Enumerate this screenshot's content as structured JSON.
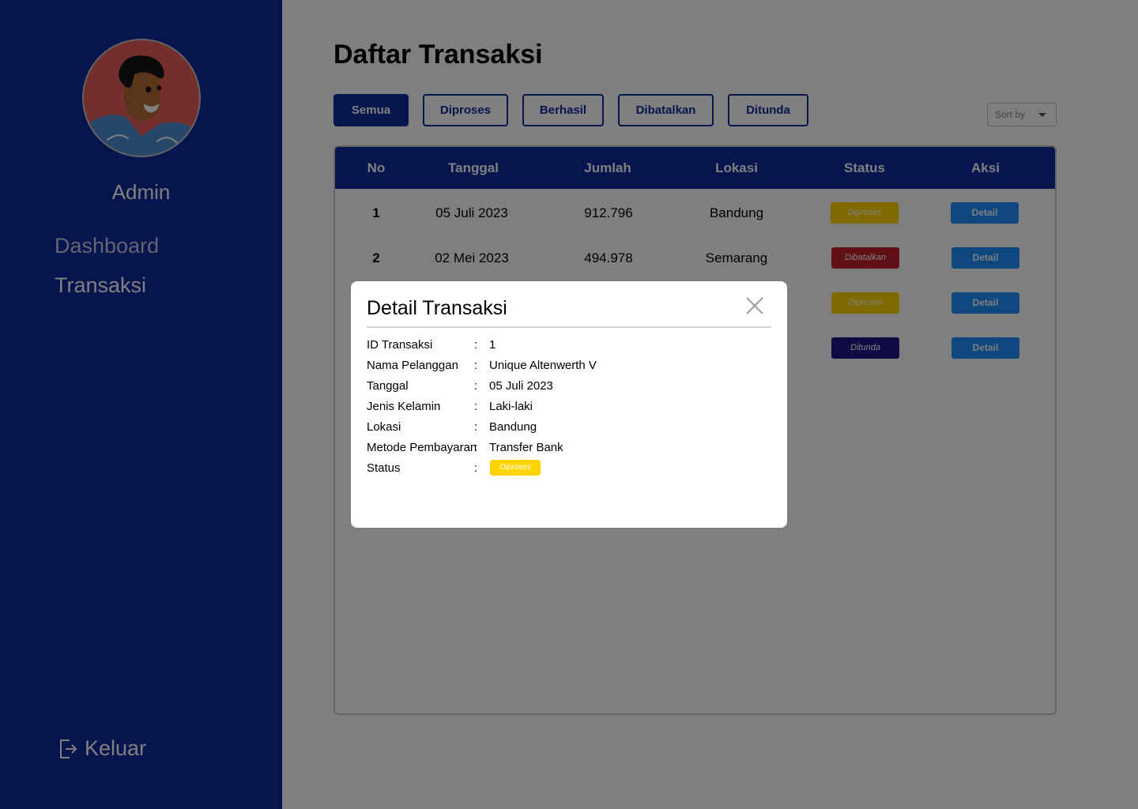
{
  "sidebar": {
    "user_name": "Admin",
    "nav": [
      {
        "label": "Dashboard"
      },
      {
        "label": "Transaksi"
      }
    ],
    "logout_label": "Keluar"
  },
  "main": {
    "title": "Daftar Transaksi",
    "filters": [
      "Semua",
      "Diproses",
      "Berhasil",
      "Dibatalkan",
      "Ditunda"
    ],
    "active_filter": "Semua",
    "sort_label": "Sort by",
    "table": {
      "headers": [
        "No",
        "Tanggal",
        "Jumlah",
        "Lokasi",
        "Status",
        "Aksi"
      ],
      "rows": [
        {
          "no": "1",
          "tanggal": "05 Juli 2023",
          "jumlah": "912.796",
          "lokasi": "Bandung",
          "status": "Diproses",
          "action": "Detail"
        },
        {
          "no": "2",
          "tanggal": "02 Mei 2023",
          "jumlah": "494.978",
          "lokasi": "Semarang",
          "status": "Dibatalkan",
          "action": "Detail"
        },
        {
          "no": "",
          "tanggal": "",
          "jumlah": "",
          "lokasi": "",
          "status": "Diproses",
          "action": "Detail"
        },
        {
          "no": "",
          "tanggal": "",
          "jumlah": "",
          "lokasi": "",
          "status": "Ditunda",
          "action": "Detail"
        }
      ]
    }
  },
  "modal": {
    "title": "Detail Transaksi",
    "fields": [
      {
        "label": "ID Transaksi",
        "value": "1"
      },
      {
        "label": "Nama Pelanggan",
        "value": "Unique Altenwerth V"
      },
      {
        "label": "Tanggal",
        "value": "05 Juli 2023"
      },
      {
        "label": "Jenis Kelamin",
        "value": "Laki-laki"
      },
      {
        "label": "Lokasi",
        "value": "Bandung"
      },
      {
        "label": "Metode Pembayaran",
        "value": "Transfer Bank"
      },
      {
        "label": "Status",
        "value": "Diproses"
      }
    ],
    "separator": ":"
  },
  "icons": {
    "close": "close-icon",
    "logout": "logout-icon",
    "sort": "chevron-down-icon",
    "avatar": "user-avatar"
  },
  "colors": {
    "sidebar": "#0e2a9e",
    "primary": "#0e2a9e",
    "diproses": "#ffd400",
    "dibatalkan": "#c0232e",
    "ditunda": "#1c178a",
    "detail_button": "#1e90ff"
  }
}
